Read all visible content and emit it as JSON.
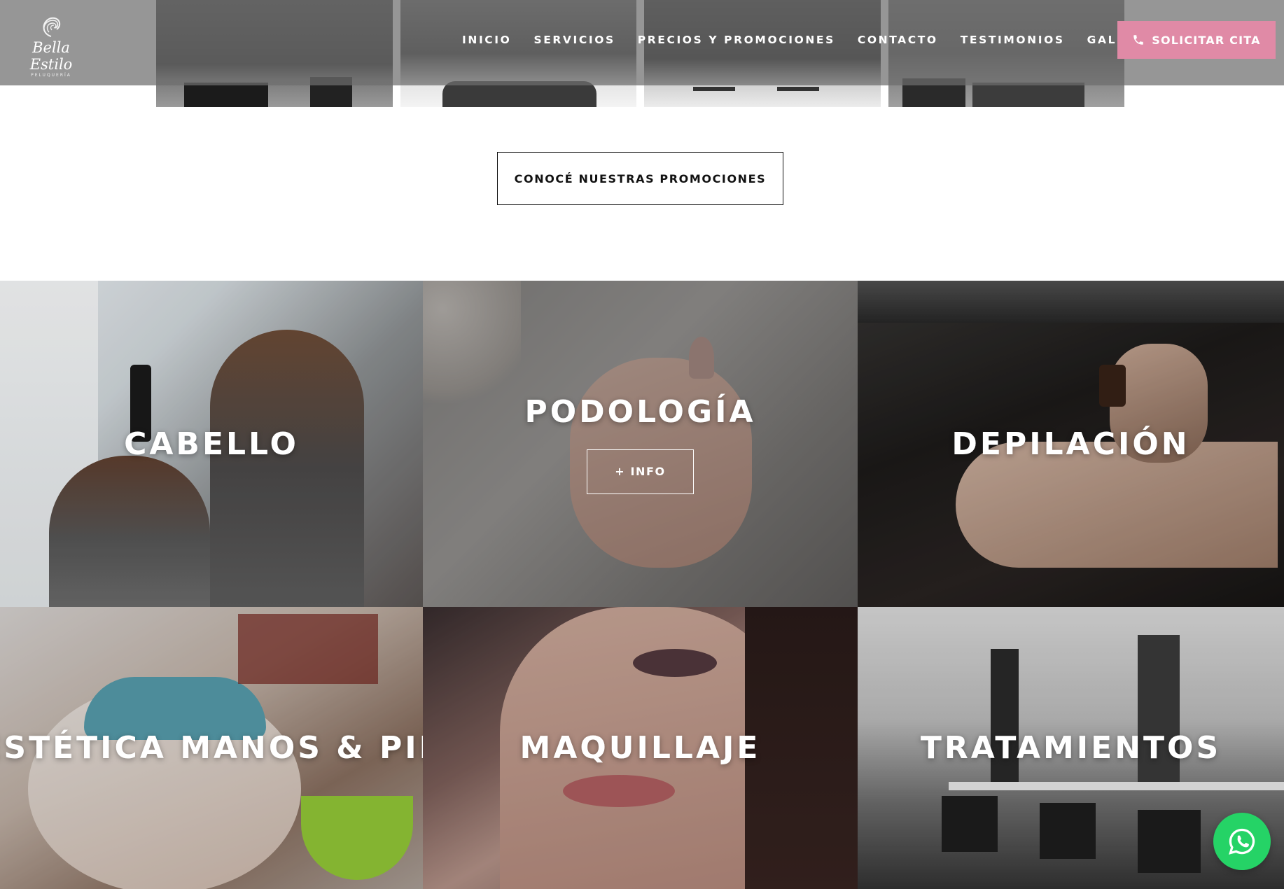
{
  "brand": {
    "logo_script": "Bella Estilo",
    "logo_sub": "PELUQUERÍA"
  },
  "nav": {
    "items": [
      {
        "label": "INICIO"
      },
      {
        "label": "SERVICIOS"
      },
      {
        "label": "PRECIOS Y PROMOCIONES"
      },
      {
        "label": "CONTACTO"
      },
      {
        "label": "TESTIMONIOS"
      },
      {
        "label": "GALERÍA"
      }
    ],
    "cta_label": "SOLICITAR CITA",
    "cta_icon": "phone-icon",
    "cta_color": "#e08aa6"
  },
  "promo": {
    "button_label": "CONOCÉ NUESTRAS PROMOCIONES"
  },
  "services": [
    {
      "title": "CABELLO"
    },
    {
      "title": "PODOLOGÍA",
      "button_label": "+ INFO"
    },
    {
      "title": "DEPILACIÓN"
    },
    {
      "title": "ESTÉTICA MANOS & PIE"
    },
    {
      "title": "MAQUILLAJE"
    },
    {
      "title": "TRATAMIENTOS"
    }
  ],
  "floating": {
    "whatsapp_icon": "whatsapp-icon",
    "whatsapp_color": "#25d366"
  }
}
